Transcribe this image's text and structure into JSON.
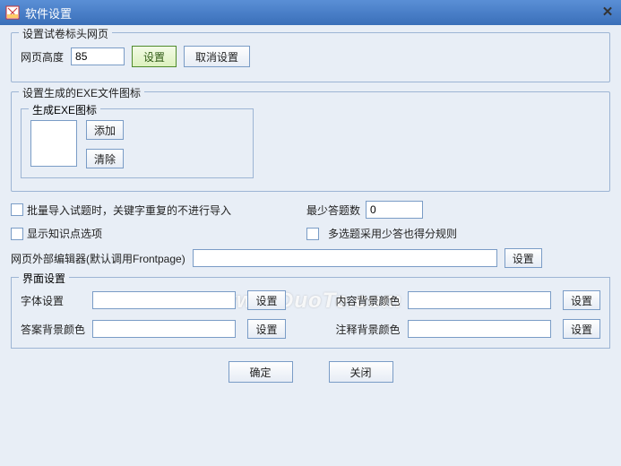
{
  "window": {
    "title": "软件设置"
  },
  "group_header": {
    "legend": "设置试卷标头网页",
    "height_label": "网页高度",
    "height_value": "85",
    "set_btn": "设置",
    "cancel_btn": "取消设置"
  },
  "group_exe": {
    "legend": "设置生成的EXE文件图标",
    "sub_legend": "生成EXE图标",
    "add_btn": "添加",
    "clear_btn": "清除"
  },
  "batch": {
    "import_label": "批量导入试题时，关键字重复的不进行导入",
    "show_knowledge_label": "显示知识点选项",
    "min_answers_label": "最少答题数",
    "min_answers_value": "0",
    "multi_partial_label": "多选题采用少答也得分规则"
  },
  "editor": {
    "label": "网页外部编辑器(默认调用Frontpage)",
    "value": "",
    "set_btn": "设置"
  },
  "ui": {
    "legend": "界面设置",
    "font_label": "字体设置",
    "font_value": "",
    "content_bg_label": "内容背景颜色",
    "content_bg_value": "",
    "answer_bg_label": "答案背景颜色",
    "answer_bg_value": "",
    "note_bg_label": "注释背景颜色",
    "note_bg_value": "",
    "set_btn": "设置"
  },
  "footer": {
    "ok": "确定",
    "close": "关闭"
  },
  "watermark": "www.DuoTe.com"
}
